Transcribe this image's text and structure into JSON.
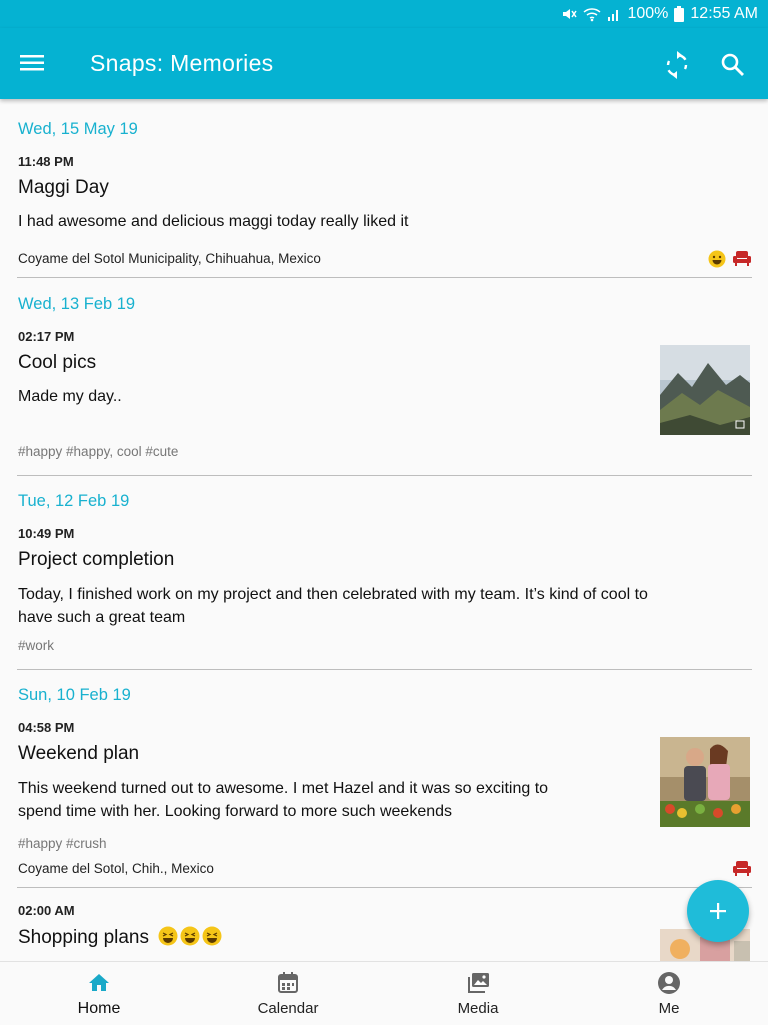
{
  "statusbar": {
    "battery": "100%",
    "time": "12:55 AM"
  },
  "appbar": {
    "title": "Snaps: Memories"
  },
  "entries": [
    {
      "date": "Wed, 15 May 19",
      "time": "11:48 PM",
      "title": "Maggi Day",
      "body": "I had awesome and delicious maggi today really liked it",
      "location": "Coyame del Sotol Municipality, Chihuahua, Mexico",
      "icons": [
        "grin-emoji-icon",
        "armchair-icon"
      ]
    },
    {
      "date": "Wed, 13 Feb 19",
      "time": "02:17 PM",
      "title": "Cool pics",
      "body": "Made my day..",
      "tags": "#happy #happy, cool #cute",
      "thumbnail": "mountain-landscape-photo"
    },
    {
      "date": "Tue, 12 Feb 19",
      "time": "10:49 PM",
      "title": "Project completion",
      "body_line1": "Today, I finished work on my project and then celebrated with my team. It’s kind of cool to",
      "body_line2": "have such a great team",
      "tags": "#work"
    },
    {
      "date": "Sun, 10 Feb 19",
      "time": "04:58 PM",
      "title": "Weekend plan",
      "body_line1": "This weekend turned out to awesome. I met Hazel and it was so exciting to",
      "body_line2": "spend time with her. Looking forward to more such weekends",
      "tags": "#happy #crush",
      "location": "Coyame del Sotol, Chih., Mexico",
      "thumbnail": "couple-market-photo",
      "icons": [
        "armchair-icon"
      ]
    },
    {
      "time": "02:00 AM",
      "title": "Shopping plans",
      "thumbnail": "shopping-photo"
    }
  ],
  "nav": [
    {
      "label": "Home",
      "icon": "home-icon",
      "active": true
    },
    {
      "label": "Calendar",
      "icon": "calendar-icon",
      "active": false
    },
    {
      "label": "Media",
      "icon": "media-icon",
      "active": false
    },
    {
      "label": "Me",
      "icon": "account-icon",
      "active": false
    }
  ],
  "colors": {
    "primary": "#05b2d2",
    "accent": "#1fbcd9",
    "date_text": "#18b1cf",
    "emoji": "#f5c518",
    "armchair": "#c62828"
  }
}
